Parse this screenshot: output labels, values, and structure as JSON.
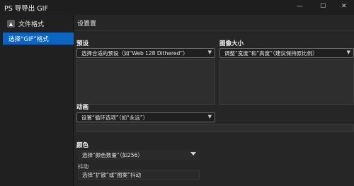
{
  "window": {
    "title": "PS 导导出 GIF",
    "minimize": "—",
    "maximize": "☐",
    "close": "✕"
  },
  "sidebar": {
    "header": "文件格式",
    "items": [
      {
        "label": "选择“GIF”格式"
      }
    ]
  },
  "main": {
    "title": "设置置",
    "preset": {
      "label": "预设",
      "value": "选择合适的预设（如“Web 128 Dithered”）"
    },
    "image_size": {
      "label": "图像大小",
      "value": "调整“宽度”和“高度”（建议保持原比例）"
    },
    "animation": {
      "label": "动画",
      "value": "设置“循环选项”（如“永远”）"
    },
    "color": {
      "label": "颜色",
      "value": "选择“颜色数量”（如256）"
    },
    "dither": {
      "label": "抖动",
      "value": "选择“扩散”或“图案”抖动"
    }
  },
  "colors": {
    "accent": "#0a66c2",
    "background": "#262626",
    "sidebar": "#202020"
  }
}
